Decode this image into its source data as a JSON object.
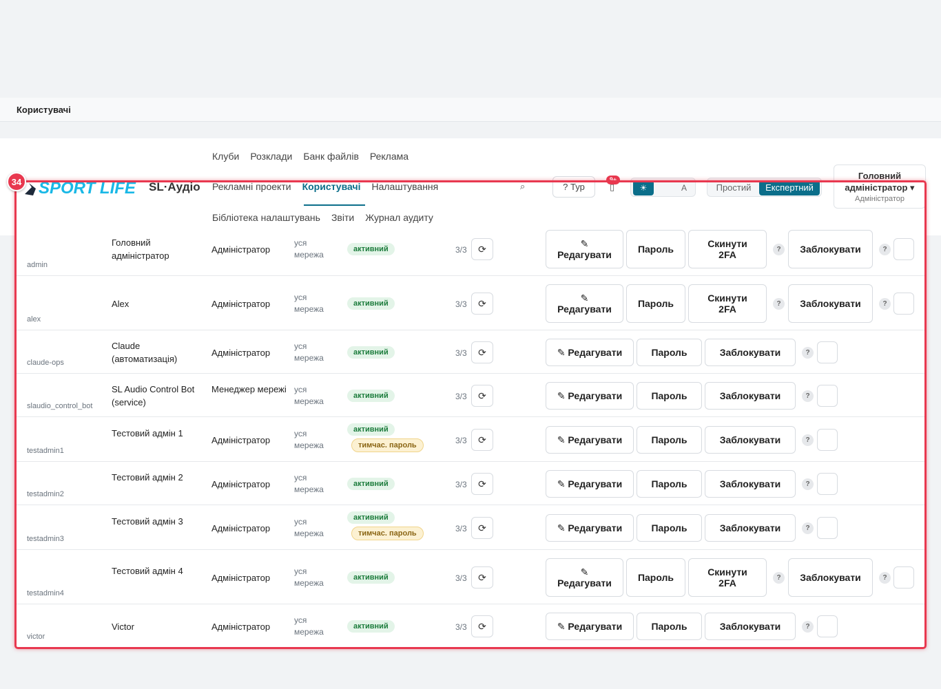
{
  "page": {
    "title": "Користувачі"
  },
  "brand": {
    "app": "SL·Аудіо",
    "logo": "SPORT LIFE"
  },
  "nav": {
    "row1": [
      "Клуби",
      "Розклади",
      "Банк файлів",
      "Реклама"
    ],
    "row2": [
      "Рекламні проекти",
      "Користувачі",
      "Налаштування"
    ],
    "row3": [
      "Бібліотека налаштувань",
      "Звіти",
      "Журнал аудиту"
    ],
    "active": "Користувачі"
  },
  "header": {
    "tour_label": "Тур",
    "notif_count": "9+",
    "theme": {
      "light": "☀",
      "dark": "",
      "auto": "A"
    },
    "mode": {
      "simple": "Простий",
      "expert": "Експертний",
      "active": "Експертний"
    },
    "user": {
      "name": "Головний адміністратор ▾",
      "role": "Адміністратор"
    }
  },
  "highlight": {
    "number": "34"
  },
  "labels": {
    "edit": "✎ Редагувати",
    "password": "Пароль",
    "reset2fa": "Скинути 2FA",
    "block": "Заблокувати",
    "help": "?",
    "refresh": "⟳"
  },
  "rows": [
    {
      "login": "admin",
      "name": "Головний адміністратор",
      "role": "Адміністратор",
      "scope": "уся мережа",
      "status": "активний",
      "temp": "",
      "count": "3/3",
      "expanded": true
    },
    {
      "login": "alex",
      "name": "Alex",
      "role": "Адміністратор",
      "scope": "уся мережа",
      "status": "активний",
      "temp": "",
      "count": "3/3",
      "expanded": true
    },
    {
      "login": "claude-ops",
      "name": "Claude (автоматизація)",
      "role": "Адміністратор",
      "scope": "уся мережа",
      "status": "активний",
      "temp": "",
      "count": "3/3",
      "expanded": false
    },
    {
      "login": "slaudio_control_bot",
      "name": "SL Audio Control Bot (service)",
      "role": "Менеджер мережі",
      "scope": "уся мережа",
      "status": "активний",
      "temp": "",
      "count": "3/3",
      "expanded": false
    },
    {
      "login": "testadmin1",
      "name": "Тестовий адмін 1",
      "role": "Адміністратор",
      "scope": "уся мережа",
      "status": "активний",
      "temp": "тимчас. пароль",
      "count": "3/3",
      "expanded": false
    },
    {
      "login": "testadmin2",
      "name": "Тестовий адмін 2",
      "role": "Адміністратор",
      "scope": "уся мережа",
      "status": "активний",
      "temp": "",
      "count": "3/3",
      "expanded": false
    },
    {
      "login": "testadmin3",
      "name": "Тестовий адмін 3",
      "role": "Адміністратор",
      "scope": "уся мережа",
      "status": "активний",
      "temp": "тимчас. пароль",
      "count": "3/3",
      "expanded": false
    },
    {
      "login": "testadmin4",
      "name": "Тестовий адмін 4",
      "role": "Адміністратор",
      "scope": "уся мережа",
      "status": "активний",
      "temp": "",
      "count": "3/3",
      "expanded": true
    },
    {
      "login": "victor",
      "name": "Victor",
      "role": "Адміністратор",
      "scope": "уся мережа",
      "status": "активний",
      "temp": "",
      "count": "3/3",
      "expanded": false
    }
  ]
}
